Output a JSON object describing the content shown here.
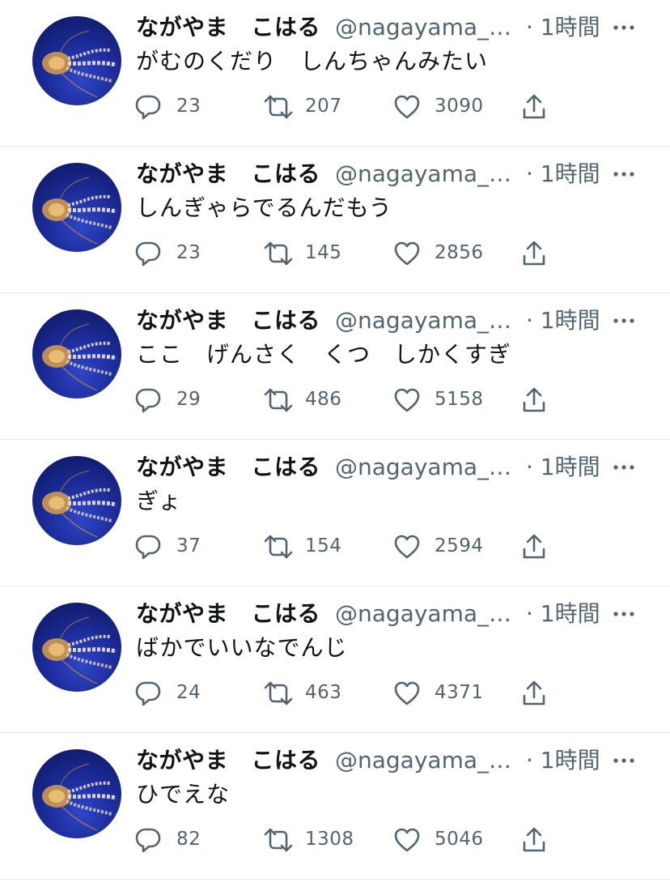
{
  "colors": {
    "text_primary": "#0f1419",
    "text_secondary": "#536471",
    "divider": "#e7e9ec",
    "avatar_bg": "#1b2b98"
  },
  "icons": {
    "reply": "speech-bubble-icon",
    "retweet": "retweet-arrows-icon",
    "like": "heart-outline-icon",
    "share": "share-upload-icon",
    "more": "three-dots-icon"
  },
  "tweets": [
    {
      "display_name": "ながやま　こはる",
      "handle": "@nagayama_…",
      "time": "· 1時間",
      "text": "がむのくだり　しんちゃんみたい",
      "replies": "23",
      "retweets": "207",
      "likes": "3090"
    },
    {
      "display_name": "ながやま　こはる",
      "handle": "@nagayama_…",
      "time": "· 1時間",
      "text": "しんぎゃらでるんだもう",
      "replies": "23",
      "retweets": "145",
      "likes": "2856"
    },
    {
      "display_name": "ながやま　こはる",
      "handle": "@nagayama_…",
      "time": "· 1時間",
      "text": "ここ　げんさく　くつ　しかくすぎ",
      "replies": "29",
      "retweets": "486",
      "likes": "5158"
    },
    {
      "display_name": "ながやま　こはる",
      "handle": "@nagayama_…",
      "time": "· 1時間",
      "text": "ぎょ",
      "replies": "37",
      "retweets": "154",
      "likes": "2594"
    },
    {
      "display_name": "ながやま　こはる",
      "handle": "@nagayama_…",
      "time": "· 1時間",
      "text": "ばかでいいなでんじ",
      "replies": "24",
      "retweets": "463",
      "likes": "4371"
    },
    {
      "display_name": "ながやま　こはる",
      "handle": "@nagayama_…",
      "time": "· 1時間",
      "text": "ひでえな",
      "replies": "82",
      "retweets": "1308",
      "likes": "5046"
    }
  ]
}
